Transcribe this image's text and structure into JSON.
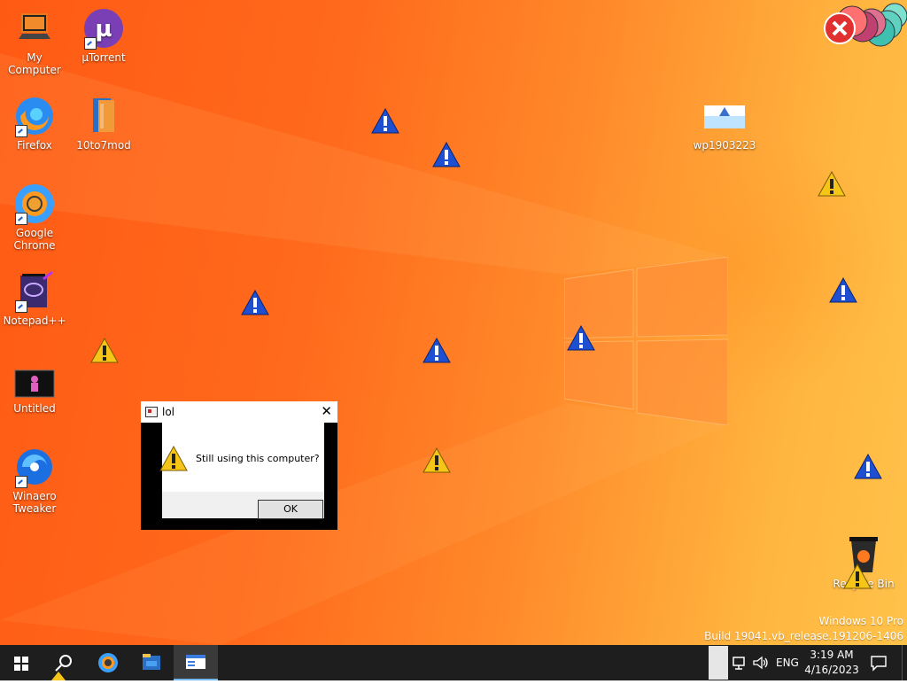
{
  "desktop_icons": [
    {
      "label": "My Computer",
      "icon": "computer-icon"
    },
    {
      "label": "µTorrent",
      "icon": "utorrent-icon"
    },
    {
      "label": "Firefox",
      "icon": "firefox-icon"
    },
    {
      "label": "10to7mod",
      "icon": "folder-icon"
    },
    {
      "label": "Google Chrome",
      "icon": "chrome-icon"
    },
    {
      "label": "Notepad++",
      "icon": "notepadpp-icon"
    },
    {
      "label": "Untitled",
      "icon": "image-file-icon"
    },
    {
      "label": "Winaero Tweaker",
      "icon": "winaero-icon"
    },
    {
      "label": "wp1903223",
      "icon": "image-file-icon"
    },
    {
      "label": "Recycle Bin",
      "icon": "recycle-bin-icon"
    }
  ],
  "dialog": {
    "title": "lol",
    "message": "Still using this computer?",
    "ok_label": "OK",
    "close_glyph": "✕"
  },
  "watermark": {
    "edition": "Windows 10 Pro",
    "build": "Build 19041.vb_release.191206-1406"
  },
  "taskbar": {
    "language": "ENG",
    "time": "3:19 AM",
    "date": "4/16/2023"
  },
  "colors": {
    "wallpaper_start": "#ff5a14",
    "wallpaper_end": "#ffc24a",
    "taskbar": "#1e1e1e",
    "warning_blue": "#1f4fd1",
    "warning_yellow": "#f5c518"
  }
}
